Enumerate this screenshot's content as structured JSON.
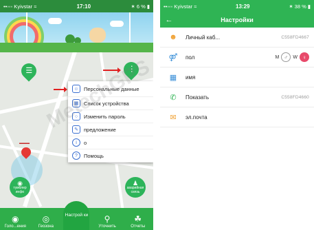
{
  "left_screen": {
    "status_bar": {
      "carrier": "••◦◦◦ Kyivstar ≈",
      "time": "17:10",
      "battery": "✶ 6 % ▮"
    },
    "popup_menu": [
      {
        "icon": "person-card-icon",
        "label": "Персональные данные"
      },
      {
        "icon": "device-list-icon",
        "label": "Список устройства"
      },
      {
        "icon": "lock-icon",
        "label": "Изменить пароль"
      },
      {
        "icon": "pencil-icon",
        "label": "предложение"
      },
      {
        "icon": "info-icon",
        "label": "о"
      },
      {
        "icon": "help-icon",
        "label": "Помощь"
      }
    ],
    "marker_label": "▬▬▬",
    "map_buttons": {
      "left": "тумблер инфо",
      "right": "аварийная связь"
    },
    "bottom_nav": [
      {
        "icon": "chat-icon",
        "label": "Голо...ения"
      },
      {
        "icon": "geofence-icon",
        "label": "Геозона"
      },
      {
        "icon": "settings-icon",
        "label": "Настрой ки"
      },
      {
        "icon": "location-icon",
        "label": "Уточнить"
      },
      {
        "icon": "footprints-icon",
        "label": "Отчеты"
      }
    ]
  },
  "right_screen": {
    "status_bar": {
      "carrier": "••◦◦◦ Kyivstar ≈",
      "time": "13:29",
      "battery": "✶ 38 % ▮"
    },
    "app_bar": {
      "back_icon": "arrow-back-icon",
      "title": "Настройки"
    },
    "rows": [
      {
        "icon": "user-card-icon",
        "label": "Личный каб...",
        "value": "C558FD4667"
      },
      {
        "icon": "gender-icon",
        "label": "пол",
        "gender_options": [
          "M",
          "W"
        ],
        "selected": "W"
      },
      {
        "icon": "id-card-icon",
        "label": "имя",
        "value": ""
      },
      {
        "icon": "phone-icon",
        "label": "Показать",
        "value": "C558FD4660"
      },
      {
        "icon": "envelope-icon",
        "label": "эл.почта",
        "value": ""
      }
    ]
  },
  "watermark": "MetechGPS",
  "colors": {
    "primary_green": "#2fb454",
    "dark_green": "#2c8c3c",
    "accent_red": "#e02020",
    "gender_female": "#e84a6b"
  }
}
